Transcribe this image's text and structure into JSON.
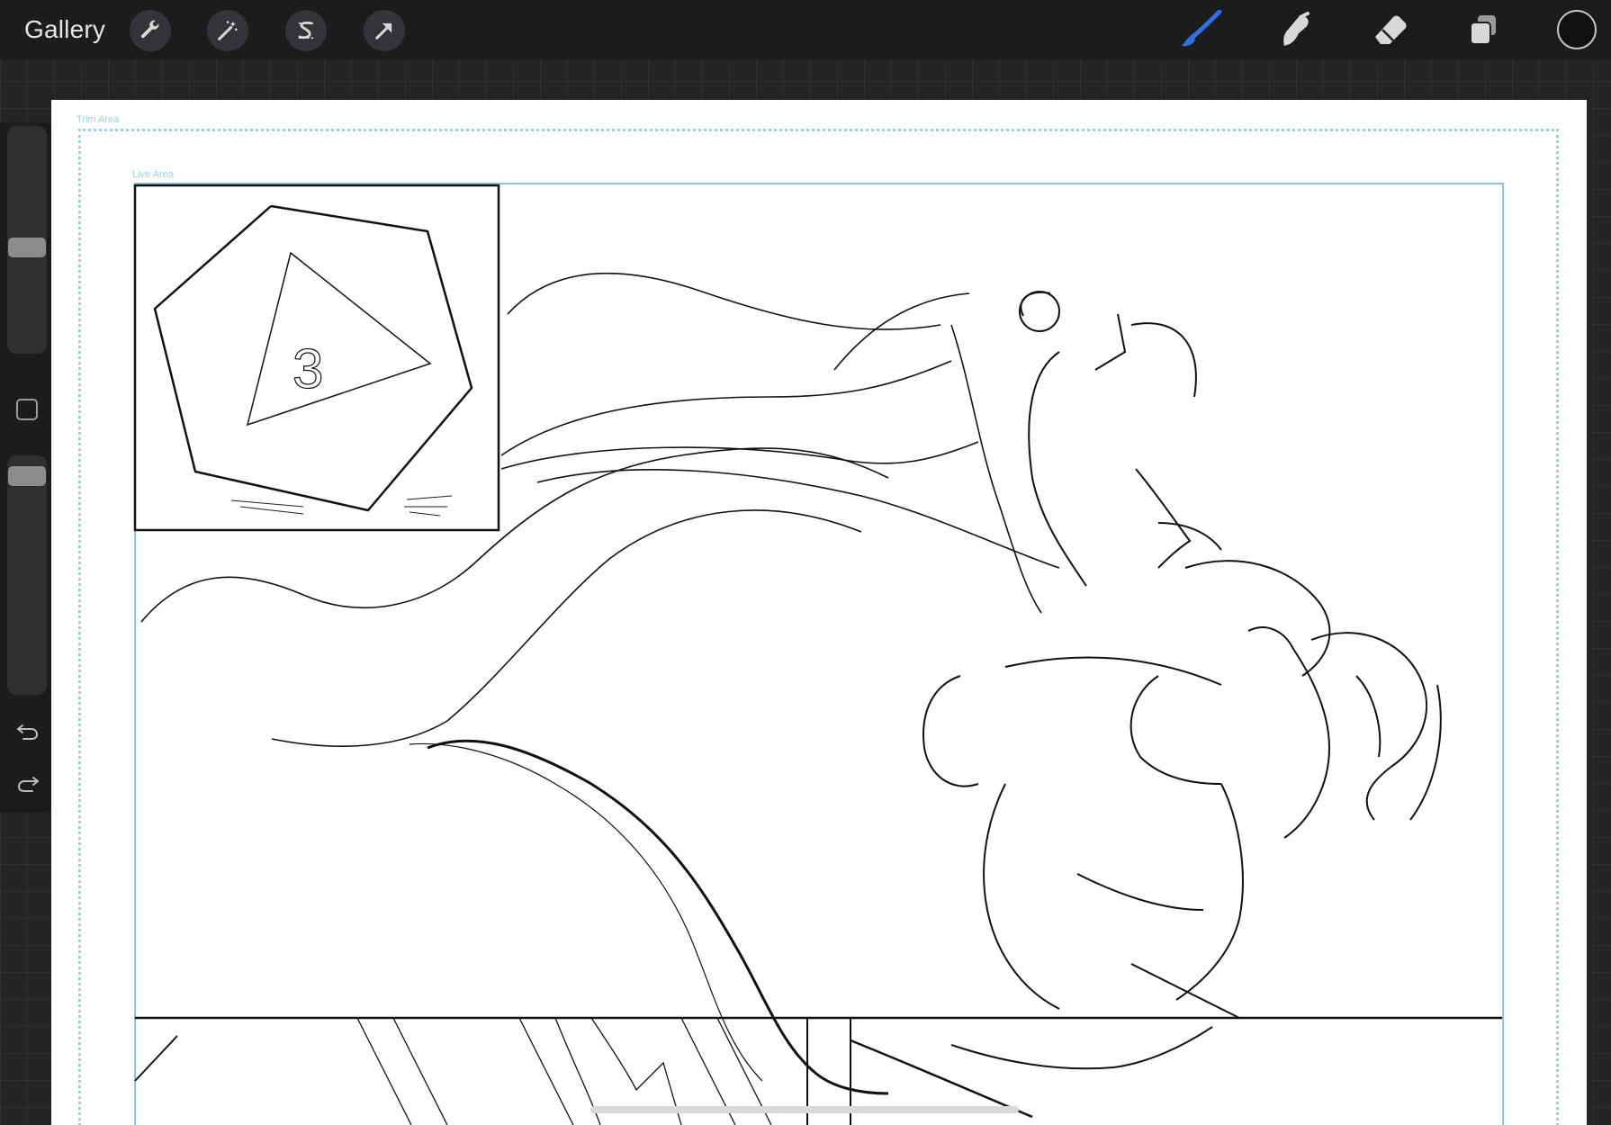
{
  "topbar": {
    "gallery_label": "Gallery",
    "left_tools": [
      {
        "name": "actions",
        "icon": "wrench-icon"
      },
      {
        "name": "adjustments",
        "icon": "magic-wand-icon"
      },
      {
        "name": "selection",
        "icon": "selection-s-icon"
      },
      {
        "name": "transform",
        "icon": "arrow-cursor-icon"
      }
    ],
    "right_tools": [
      {
        "name": "brush",
        "icon": "brush-icon",
        "active": true
      },
      {
        "name": "smudge",
        "icon": "smudge-icon"
      },
      {
        "name": "eraser",
        "icon": "eraser-icon"
      },
      {
        "name": "layers",
        "icon": "layers-icon"
      }
    ],
    "current_color": "#111111",
    "active_tool_color": "#2f6fe0"
  },
  "sidebar": {
    "brush_size_level": 0.45,
    "opacity_level": 0.95,
    "icons": [
      "modify-square-icon",
      "undo-icon",
      "redo-icon"
    ]
  },
  "canvas": {
    "trim_area_label": "Trim Area",
    "live_area_label": "Live Area",
    "guide_color": "#9fcfe3",
    "sketch_number": "3"
  }
}
